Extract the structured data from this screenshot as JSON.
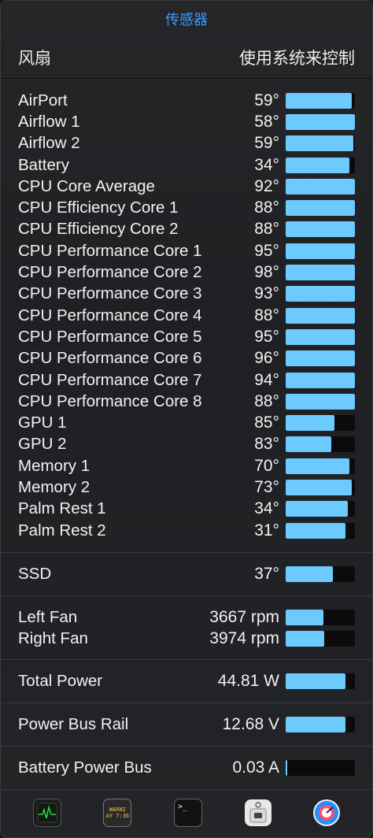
{
  "title": "传感器",
  "header": {
    "left": "风扇",
    "right": "使用系统来控制"
  },
  "colors": {
    "accent": "#3b9bff",
    "bar_fill": "#6ccaff",
    "bar_track": "#0b0b0b"
  },
  "sensors": [
    {
      "label": "AirPort",
      "value": "59°",
      "fill": 0.96
    },
    {
      "label": "Airflow 1",
      "value": "58°",
      "fill": 1.0
    },
    {
      "label": "Airflow 2",
      "value": "59°",
      "fill": 0.98
    },
    {
      "label": "Battery",
      "value": "34°",
      "fill": 0.92
    },
    {
      "label": "CPU Core Average",
      "value": "92°",
      "fill": 1.0
    },
    {
      "label": "CPU Efficiency Core 1",
      "value": "88°",
      "fill": 1.0
    },
    {
      "label": "CPU Efficiency Core 2",
      "value": "88°",
      "fill": 1.0
    },
    {
      "label": "CPU Performance Core 1",
      "value": "95°",
      "fill": 1.0
    },
    {
      "label": "CPU Performance Core 2",
      "value": "98°",
      "fill": 1.0
    },
    {
      "label": "CPU Performance Core 3",
      "value": "93°",
      "fill": 1.0
    },
    {
      "label": "CPU Performance Core 4",
      "value": "88°",
      "fill": 1.0
    },
    {
      "label": "CPU Performance Core 5",
      "value": "95°",
      "fill": 1.0
    },
    {
      "label": "CPU Performance Core 6",
      "value": "96°",
      "fill": 1.0
    },
    {
      "label": "CPU Performance Core 7",
      "value": "94°",
      "fill": 1.0
    },
    {
      "label": "CPU Performance Core 8",
      "value": "88°",
      "fill": 1.0
    },
    {
      "label": "GPU 1",
      "value": "85°",
      "fill": 0.71
    },
    {
      "label": "GPU 2",
      "value": "83°",
      "fill": 0.66
    },
    {
      "label": "Memory 1",
      "value": "70°",
      "fill": 0.92
    },
    {
      "label": "Memory 2",
      "value": "73°",
      "fill": 0.96
    },
    {
      "label": "Palm Rest 1",
      "value": "34°",
      "fill": 0.9
    },
    {
      "label": "Palm Rest 2",
      "value": "31°",
      "fill": 0.86
    }
  ],
  "ssd": {
    "label": "SSD",
    "value": "37°",
    "fill": 0.68
  },
  "fans": [
    {
      "label": "Left Fan",
      "value": "3667 rpm",
      "fill": 0.55
    },
    {
      "label": "Right Fan",
      "value": "3974 rpm",
      "fill": 0.56
    }
  ],
  "total_power": {
    "label": "Total Power",
    "value": "44.81 W",
    "fill": 0.86
  },
  "power_bus_rail": {
    "label": "Power Bus Rail",
    "value": "12.68 V",
    "fill": 0.86
  },
  "battery_power_bus": {
    "label": "Battery Power Bus",
    "value": "0.03 A",
    "fill": 0.02
  },
  "dock": {
    "console_text_line1": "WARNI",
    "console_text_line2": "AY 7:36",
    "terminal_prompt": ">_"
  }
}
